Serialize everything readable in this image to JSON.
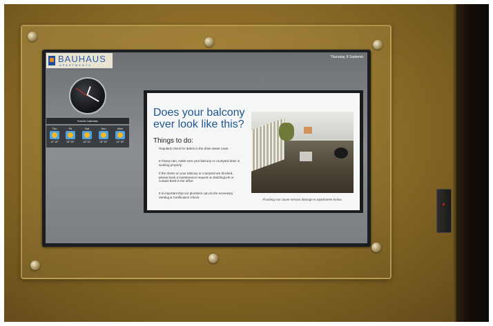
{
  "signage": {
    "brand": "BAUHAUS",
    "brand_sub": "APARTMENTS",
    "date": "Thursday, 8 Septemb",
    "calendar_label": "Events Calendar",
    "weather": [
      {
        "day": "Thu",
        "temp": "12° 22°"
      },
      {
        "day": "Fri",
        "temp": "13° 23°"
      },
      {
        "day": "Sat",
        "temp": "14° 21°"
      },
      {
        "day": "Sun",
        "temp": "13° 22°"
      },
      {
        "day": "Mon",
        "temp": "14° 19°"
      }
    ],
    "headline": "Does your balcony ever look like this?",
    "todo_title": "Things to do:",
    "todo_items": [
      "Regularly check for debris in the drain waste cover.",
      "In heavy rain, make sure your balcony or courtyard drain is working properly.",
      "If the drains on your balcony or courtyard are blocked, please book a maintenance request on BuildingLink or contact Brett in the office.",
      "It is important that our plumbers can do the necessary Venting & Certification Check."
    ],
    "photo_caption": "Flooding can cause serious damage to apartments below."
  },
  "colors": {
    "brand_blue": "#2a5aa8",
    "headline_blue": "#1f5590",
    "wall": "#8a6a26"
  }
}
